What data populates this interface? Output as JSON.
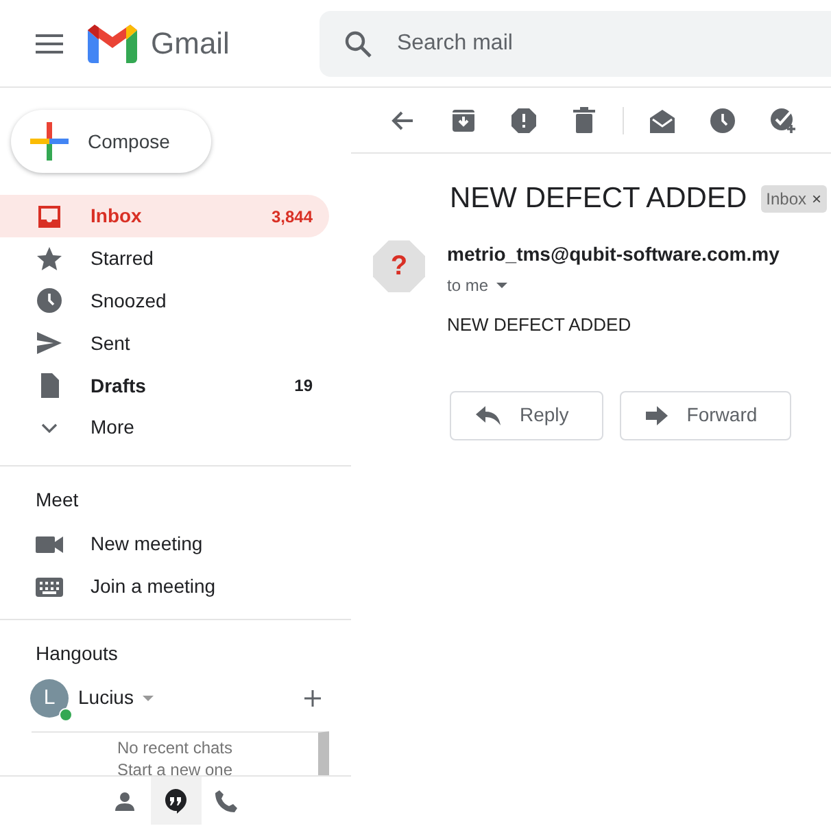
{
  "app": {
    "name": "Gmail"
  },
  "search": {
    "placeholder": "Search mail"
  },
  "compose": "Compose",
  "nav": [
    {
      "label": "Inbox",
      "count": "3,844",
      "selected": true,
      "unread": true
    },
    {
      "label": "Starred",
      "selected": false,
      "unread": false
    },
    {
      "label": "Snoozed",
      "selected": false,
      "unread": false
    },
    {
      "label": "Sent",
      "selected": false,
      "unread": false
    },
    {
      "label": "Drafts",
      "count": "19",
      "selected": false,
      "unread": true
    },
    {
      "label": "More",
      "selected": false,
      "unread": false
    }
  ],
  "meet": {
    "title": "Meet",
    "items": [
      "New meeting",
      "Join a meeting"
    ]
  },
  "hangouts": {
    "title": "Hangouts",
    "user": {
      "initial": "L",
      "name": "Lucius",
      "online": true
    },
    "empty": "No recent chats",
    "link": "Start a new one"
  },
  "chat_tabs": [
    {
      "selected": false
    },
    {
      "selected": true
    },
    {
      "selected": false
    }
  ],
  "message": {
    "subject": "NEW DEFECT ADDED",
    "label": "Inbox",
    "label_close": "×",
    "avatar": "?",
    "sender": "metrio_tms@qubit-software.com.my",
    "recipient": "to me",
    "body": "NEW DEFECT ADDED"
  },
  "actions": [
    "Reply",
    "Forward"
  ]
}
